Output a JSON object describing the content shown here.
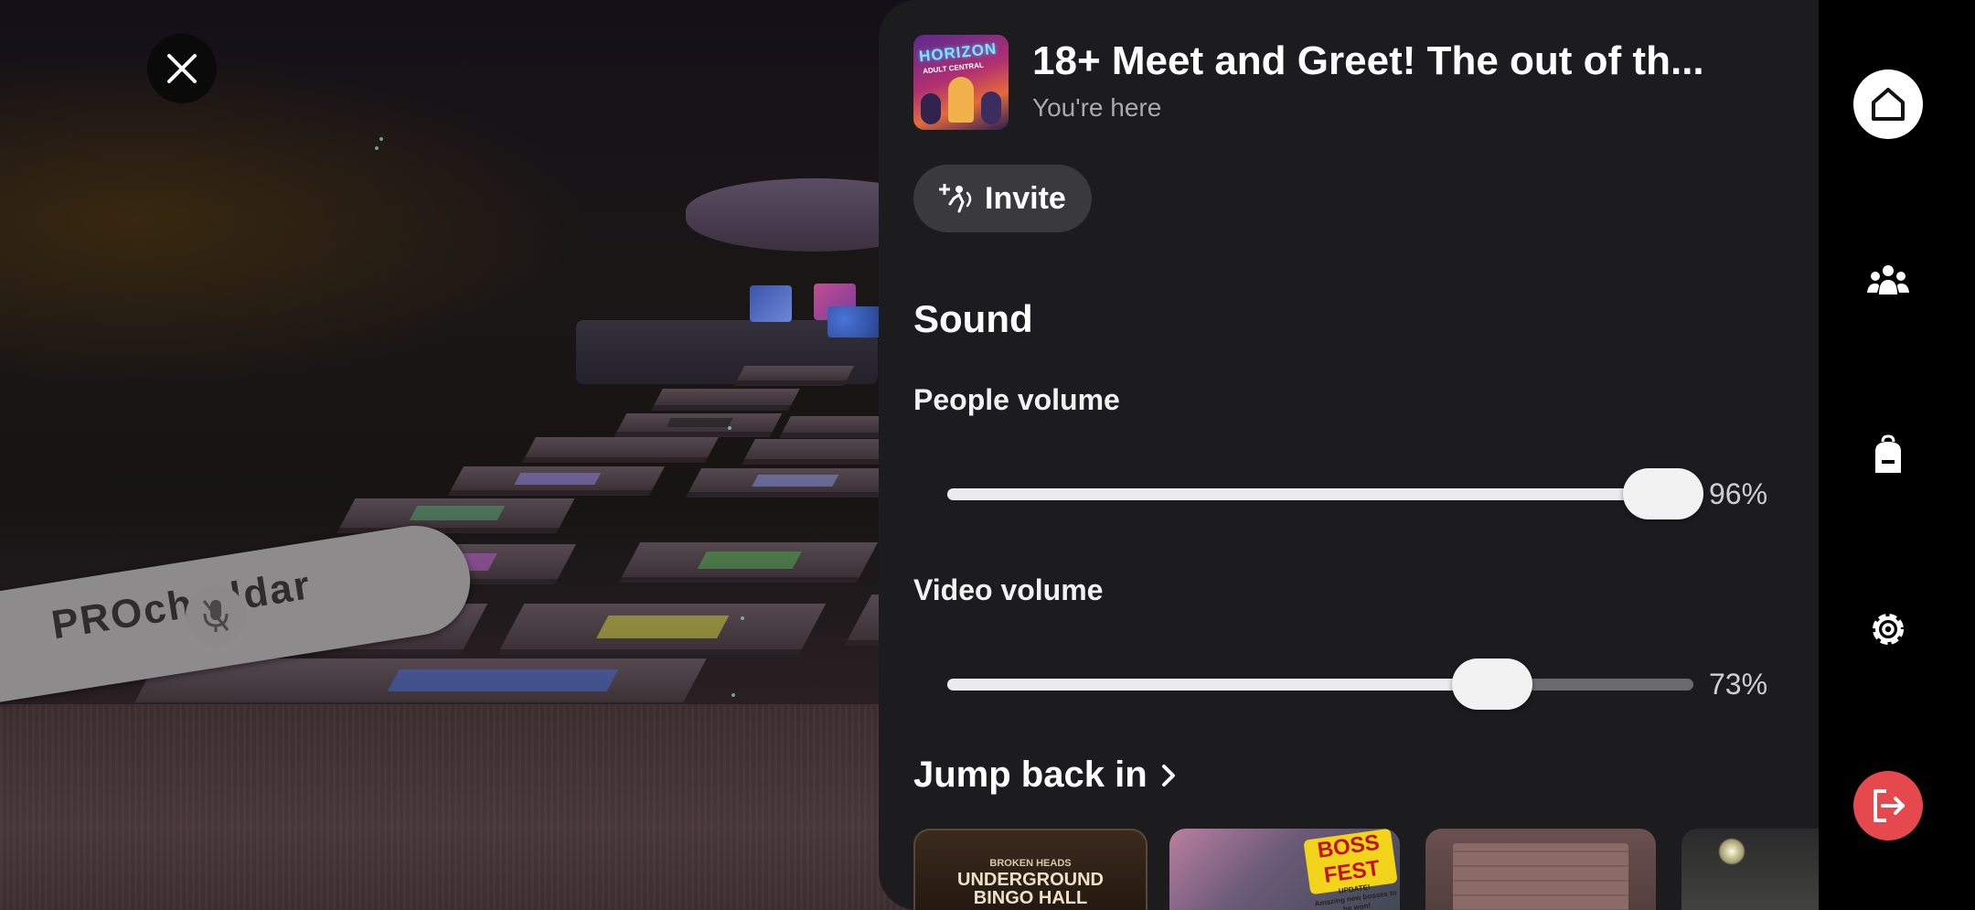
{
  "world": {
    "nametag": "PROcheddar"
  },
  "panel": {
    "title": "18+ Meet and Greet! The out of th...",
    "subtitle": "You're here",
    "thumbnail_text": [
      "HORIZON",
      "ADULT CENTRAL"
    ],
    "invite_label": "Invite",
    "sound_heading": "Sound",
    "sliders": [
      {
        "label": "People volume",
        "value": 96,
        "value_label": "96%"
      },
      {
        "label": "Video volume",
        "value": 73,
        "value_label": "73%"
      }
    ],
    "jump_back_heading": "Jump back in",
    "cards": [
      {
        "lines": [
          "BROKEN HEADS",
          "UNDERGROUND",
          "BINGO HALL"
        ]
      },
      {
        "sticker": "BOSS FEST",
        "sticker_sub": [
          "UPDATE!",
          "Amazing new bosses to be won!"
        ]
      },
      {},
      {}
    ]
  },
  "rail": {
    "icons": [
      "home-icon",
      "people-icon",
      "backpack-icon",
      "settings-icon",
      "exit-icon"
    ]
  },
  "colors": {
    "panel_bg": "#1c1c1e",
    "exit_button": "#e5484d",
    "slider_fill": "#ececec",
    "slider_track": "#6b6b6e"
  }
}
